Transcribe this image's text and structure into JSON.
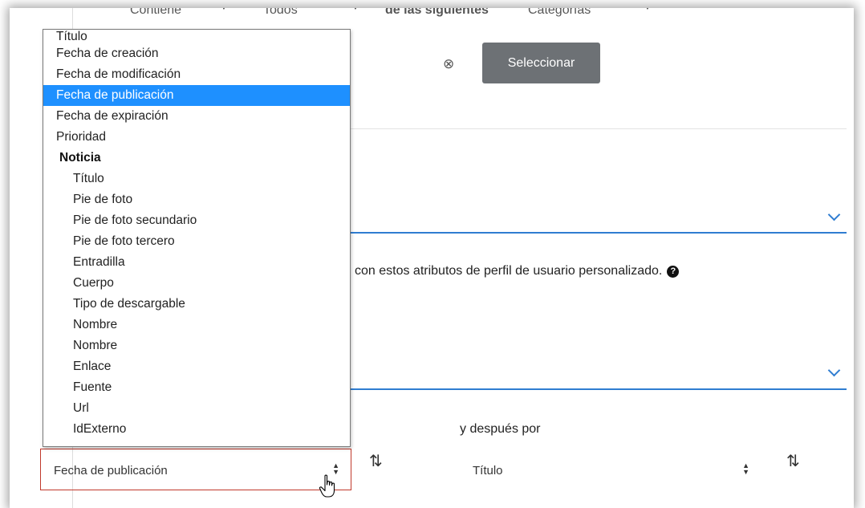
{
  "filter_row": {
    "contains": "Contiene",
    "all": "Todos",
    "of_following": "de las siguientes",
    "categories": "Categorías"
  },
  "select_button": "Seleccionar",
  "attributes_text": "con estos atributos de perfil de usuario personalizado.",
  "help_glyph": "?",
  "then_by_label": "y después por",
  "sort_primary_value": "Fecha de publicación",
  "sort_secondary_value": "Título",
  "dropdown": {
    "options": [
      "Título",
      "Fecha de creación",
      "Fecha de modificación",
      "Fecha de publicación",
      "Fecha de expiración",
      "Prioridad"
    ],
    "group_label": "Noticia",
    "group_options": [
      "Título",
      "Pie de foto",
      "Pie de foto secundario",
      "Pie de foto tercero",
      "Entradilla",
      "Cuerpo",
      "Tipo de descargable",
      "Nombre",
      "Nombre",
      "Enlace",
      "Fuente",
      "Url",
      "IdExterno"
    ],
    "selected": "Fecha de publicación"
  },
  "colors": {
    "accent": "#2f7dd1",
    "selected_bg": "#1e90ff",
    "button_bg": "#6d7175",
    "focus_border": "#c0392b"
  },
  "icons": {
    "clear": "close-circle-icon",
    "help": "help-circle-icon",
    "order": "sort-order-icon",
    "chevron": "chevron-down-icon",
    "cursor": "hand-pointer-icon"
  }
}
